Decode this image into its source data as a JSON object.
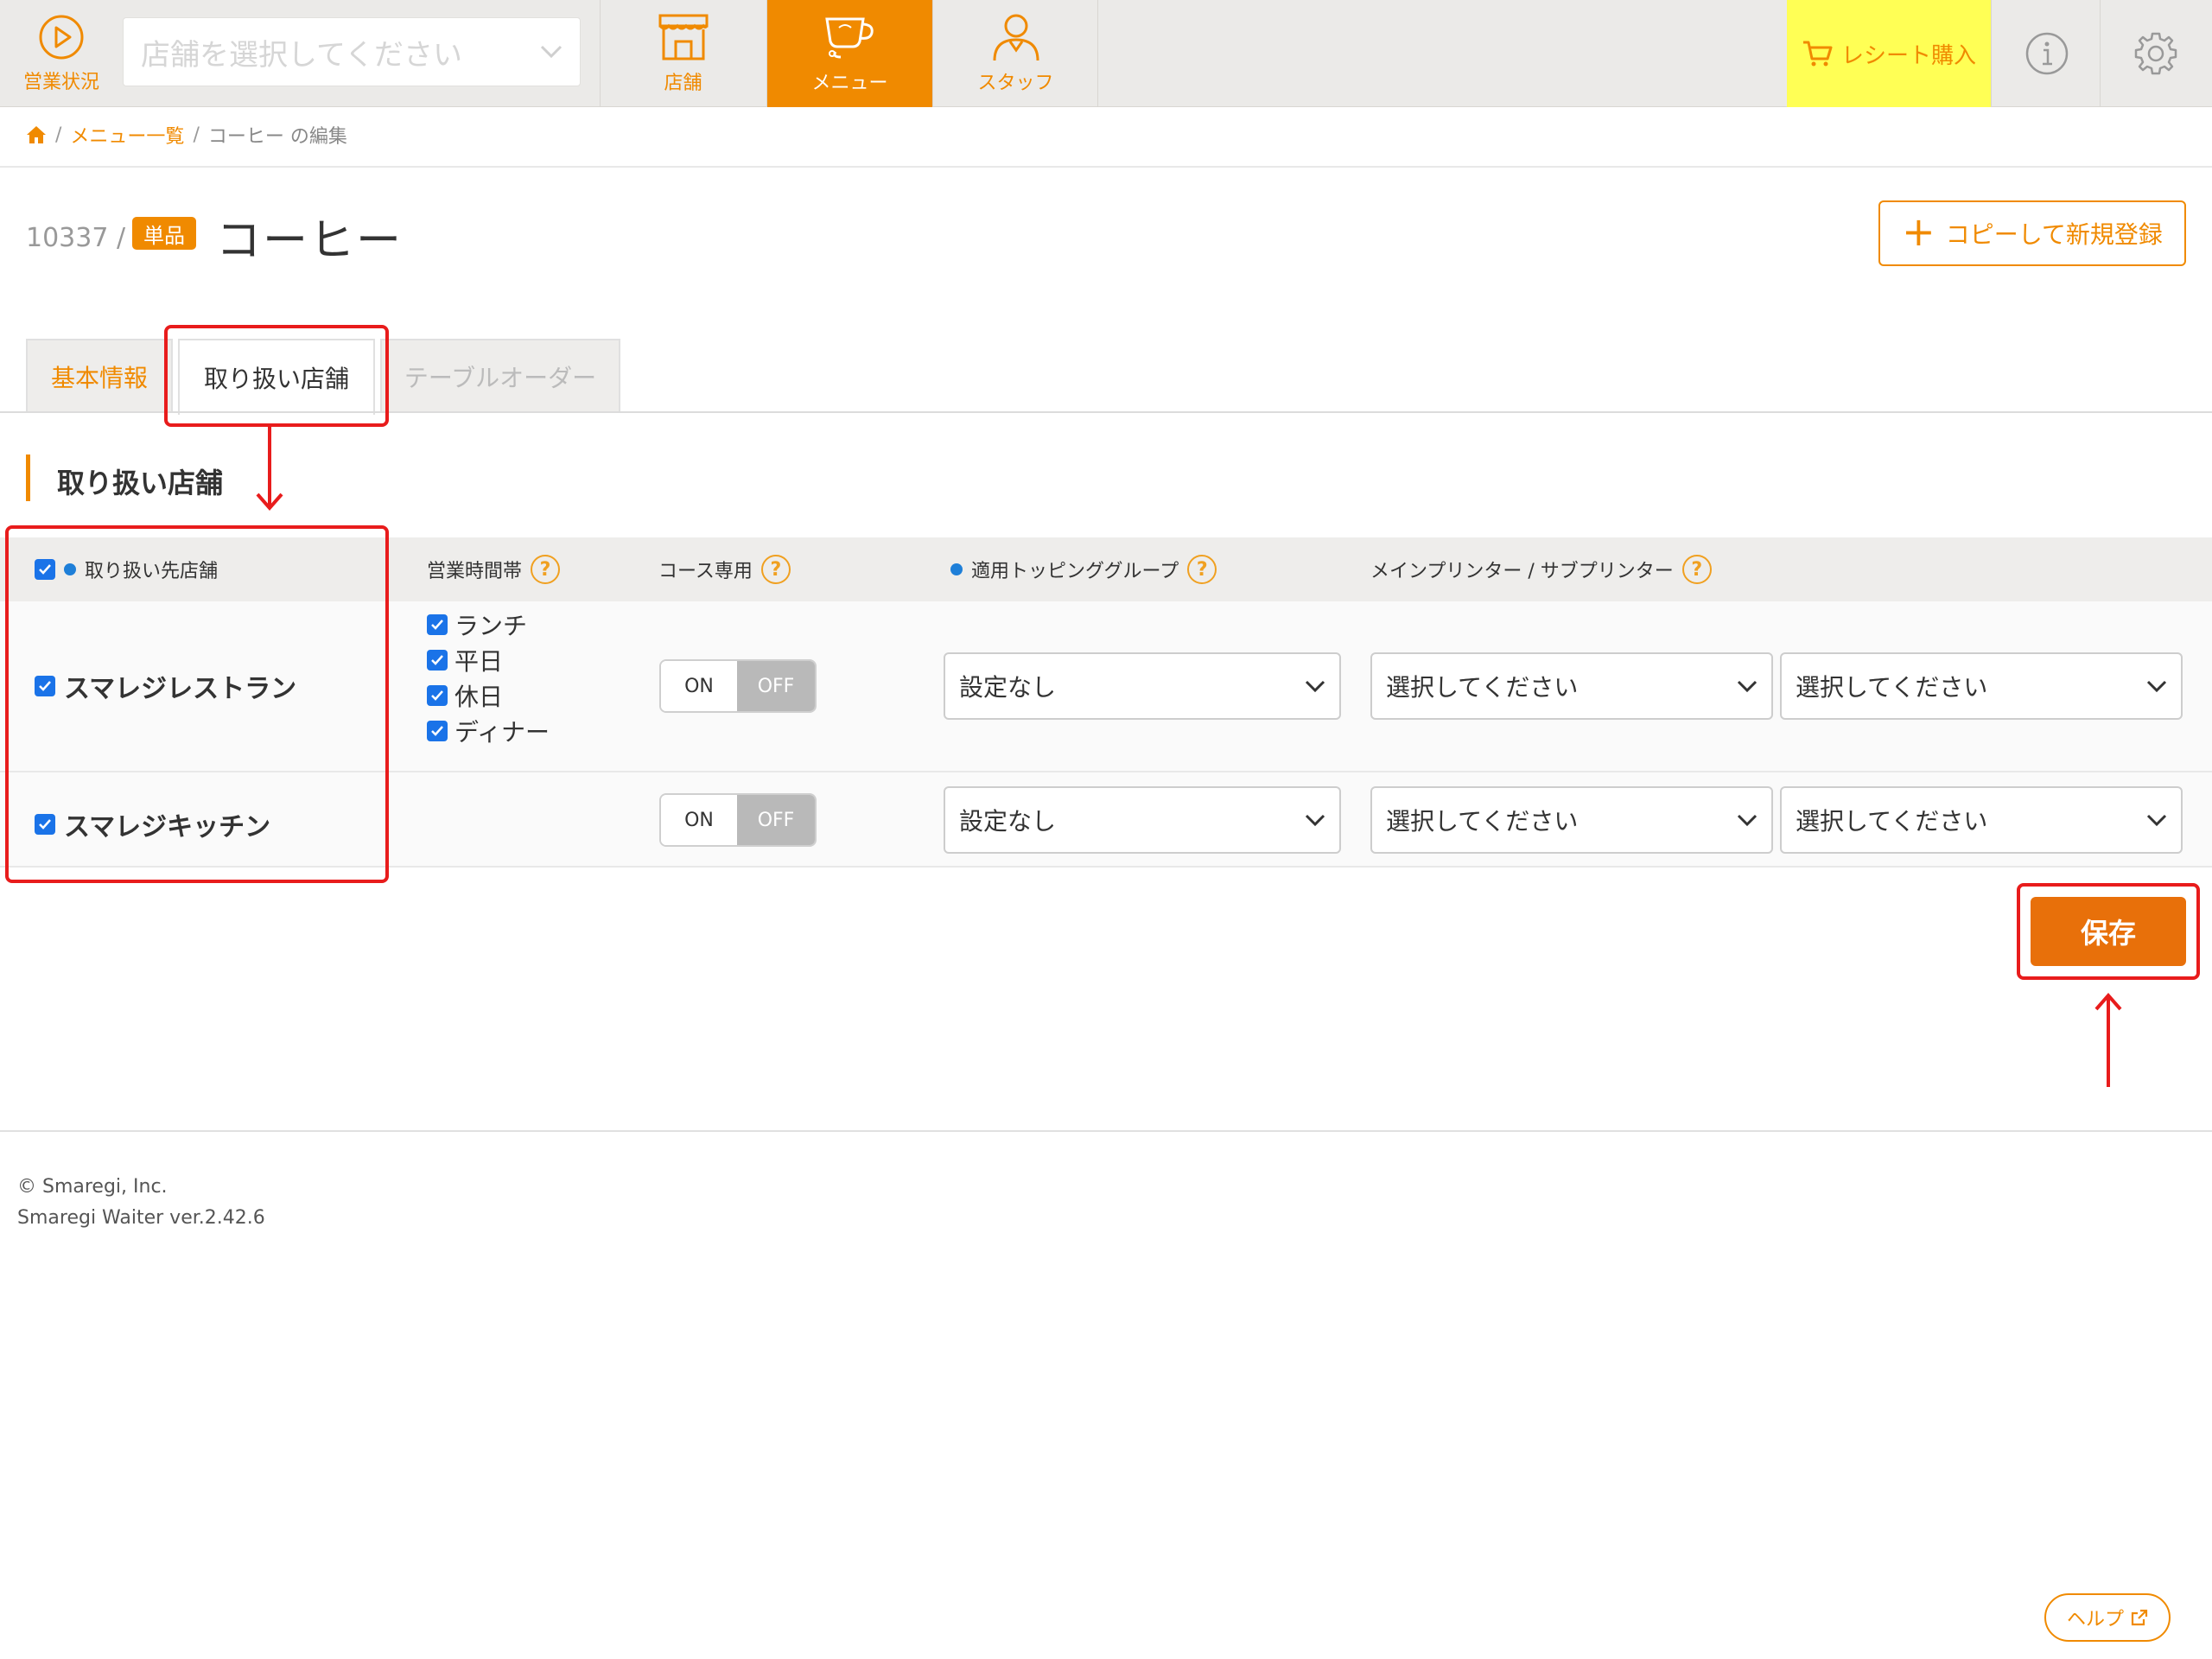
{
  "nav": {
    "status_label": "営業状況",
    "store_select_placeholder": "店舗を選択してください",
    "tabs": [
      {
        "label": "店舗",
        "icon": "store-icon",
        "active": false
      },
      {
        "label": "メニュー",
        "icon": "cup-icon",
        "active": true
      },
      {
        "label": "スタッフ",
        "icon": "staff-icon",
        "active": false
      }
    ],
    "receipt_label": "レシート購入",
    "info_icon": "info-icon",
    "settings_icon": "gear-icon"
  },
  "breadcrumb": {
    "home_icon": "home-icon",
    "menu_list": "メニュー一覧",
    "current": "コーヒー の編集"
  },
  "item": {
    "id": "10337 /",
    "badge": "単品",
    "title": "コーヒー",
    "copy_button": "コピーして新規登録"
  },
  "tabs": {
    "basic": "基本情報",
    "stores": "取り扱い店舗",
    "table_order": "テーブルオーダー"
  },
  "section": {
    "title": "取り扱い店舗"
  },
  "table": {
    "headers": {
      "store": "取り扱い先店舗",
      "hours": "営業時間帯",
      "course": "コース専用",
      "topping": "適用トッピンググループ",
      "printer": "メインプリンター / サブプリンター"
    },
    "rows": [
      {
        "store": "スマレジレストラン",
        "checked": true,
        "hours": [
          "ランチ",
          "平日",
          "休日",
          "ディナー"
        ],
        "course_on": "ON",
        "course_off": "OFF",
        "course_state": "OFF",
        "topping": "設定なし",
        "main_printer": "選択してください",
        "sub_printer": "選択してください"
      },
      {
        "store": "スマレジキッチン",
        "checked": true,
        "hours": [],
        "course_on": "ON",
        "course_off": "OFF",
        "course_state": "OFF",
        "topping": "設定なし",
        "main_printer": "選択してください",
        "sub_printer": "選択してください"
      }
    ]
  },
  "save_button": "保存",
  "footer": {
    "copyright": "© Smaregi, Inc.",
    "version": "Smaregi Waiter ver.2.42.6",
    "help": "ヘルプ"
  },
  "colors": {
    "accent": "#f08a00",
    "save": "#e8700a",
    "receipt_bg": "#ffff55",
    "annotation": "#e81c1c",
    "checkbox": "#1a73e8"
  }
}
